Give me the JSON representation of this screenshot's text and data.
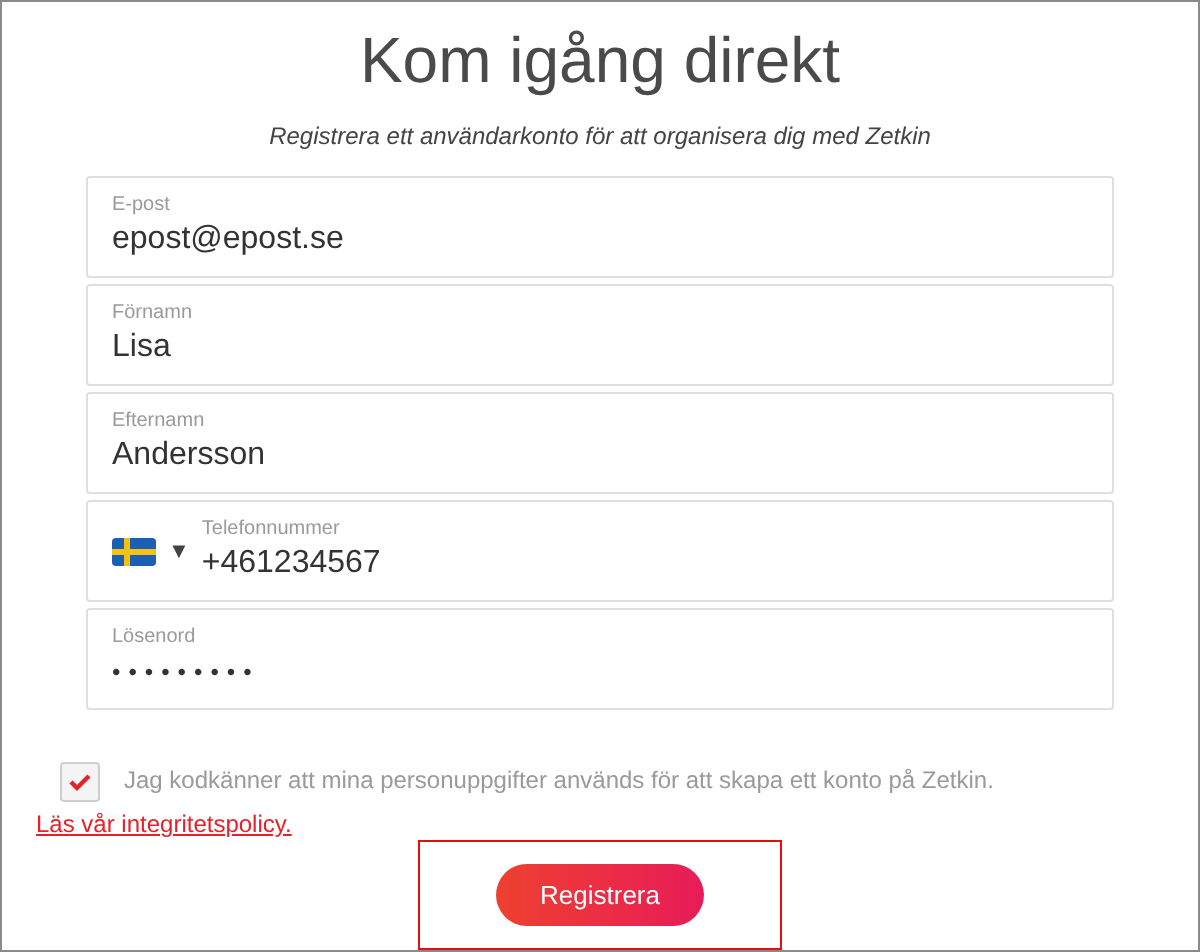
{
  "title": "Kom igång direkt",
  "subtitle": "Registrera ett användarkonto för att organisera dig med Zetkin",
  "fields": [
    {
      "kind": "text",
      "label": "E-post",
      "value": "epost@epost.se"
    },
    {
      "kind": "text",
      "label": "Förnamn",
      "value": "Lisa"
    },
    {
      "kind": "text",
      "label": "Efternamn",
      "value": "Andersson"
    },
    {
      "kind": "phone",
      "label": "Telefonnummer",
      "value": "+461234567",
      "dropdown": "▼"
    },
    {
      "kind": "password",
      "label": "Lösenord",
      "value": "•••••••••"
    }
  ],
  "consent": {
    "checked": true,
    "text": "Jag kodkänner att mina personuppgifter används för att skapa ett konto på Zetkin.",
    "link": "Läs vår integritetspolicy."
  },
  "submit": {
    "label": "Registrera",
    "highlighted": true
  }
}
